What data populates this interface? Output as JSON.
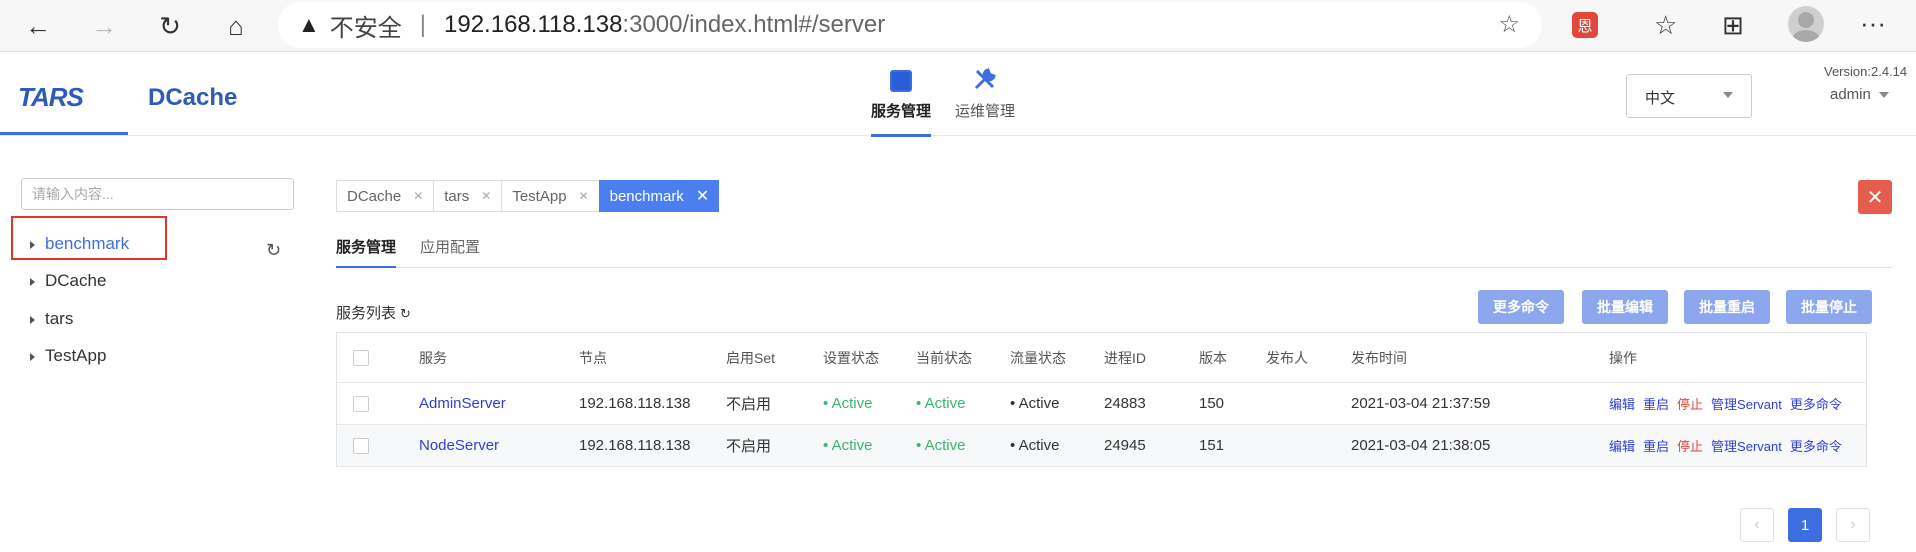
{
  "browser": {
    "back_icon": "←",
    "forward_icon": "→",
    "reload_icon": "↻",
    "home_icon": "⌂",
    "warning_icon": "▲",
    "insecure_label": "不安全",
    "url_host": "192.168.118.138",
    "url_path": ":3000/index.html#/server",
    "favorite_icon": "☆",
    "extension_label": "恩",
    "favorites_icon": "☆",
    "collections_icon": "⊞",
    "more_icon": "···"
  },
  "header": {
    "logo_tars": "TARS",
    "logo_dcache": "DCache",
    "nav": [
      {
        "label": "服务管理",
        "icon": "chip-icon",
        "active": true
      },
      {
        "label": "运维管理",
        "icon": "wrench-icon",
        "active": false
      }
    ],
    "language": "中文",
    "version": "Version:2.4.14",
    "user": "admin"
  },
  "tree": {
    "search_placeholder": "请输入内容...",
    "items": [
      {
        "label": "benchmark",
        "selected": true
      },
      {
        "label": "DCache",
        "selected": false
      },
      {
        "label": "tars",
        "selected": false
      },
      {
        "label": "TestApp",
        "selected": false
      }
    ]
  },
  "tabs": [
    {
      "label": "DCache",
      "active": false
    },
    {
      "label": "tars",
      "active": false
    },
    {
      "label": "TestApp",
      "active": false
    },
    {
      "label": "benchmark",
      "active": true
    }
  ],
  "subtabs": [
    {
      "label": "服务管理",
      "active": true
    },
    {
      "label": "应用配置",
      "active": false
    }
  ],
  "list": {
    "title": "服务列表",
    "refresh_icon": "↻",
    "actions": [
      "更多命令",
      "批量编辑",
      "批量重启",
      "批量停止"
    ]
  },
  "table": {
    "columns": [
      "服务",
      "节点",
      "启用Set",
      "设置状态",
      "当前状态",
      "流量状态",
      "进程ID",
      "版本",
      "发布人",
      "发布时间",
      "操作"
    ],
    "rows": [
      {
        "service": "AdminServer",
        "node": "192.168.118.138",
        "set": "不启用",
        "setting": "• Active",
        "current": "• Active",
        "traffic": "• Active",
        "pid": "24883",
        "version": "150",
        "publisher": "",
        "time": "2021-03-04 21:37:59"
      },
      {
        "service": "NodeServer",
        "node": "192.168.118.138",
        "set": "不启用",
        "setting": "• Active",
        "current": "• Active",
        "traffic": "• Active",
        "pid": "24945",
        "version": "151",
        "publisher": "",
        "time": "2021-03-04 21:38:05"
      }
    ],
    "ops": [
      "编辑",
      "重启",
      "停止",
      "管理Servant",
      "更多命令"
    ]
  },
  "pagination": {
    "prev_icon": "‹",
    "current": "1",
    "next_icon": "›"
  },
  "colors": {
    "accent": "#3c6ee0",
    "danger": "#e0473d",
    "active_green": "#3ab56e",
    "button": "#8da7ef"
  }
}
